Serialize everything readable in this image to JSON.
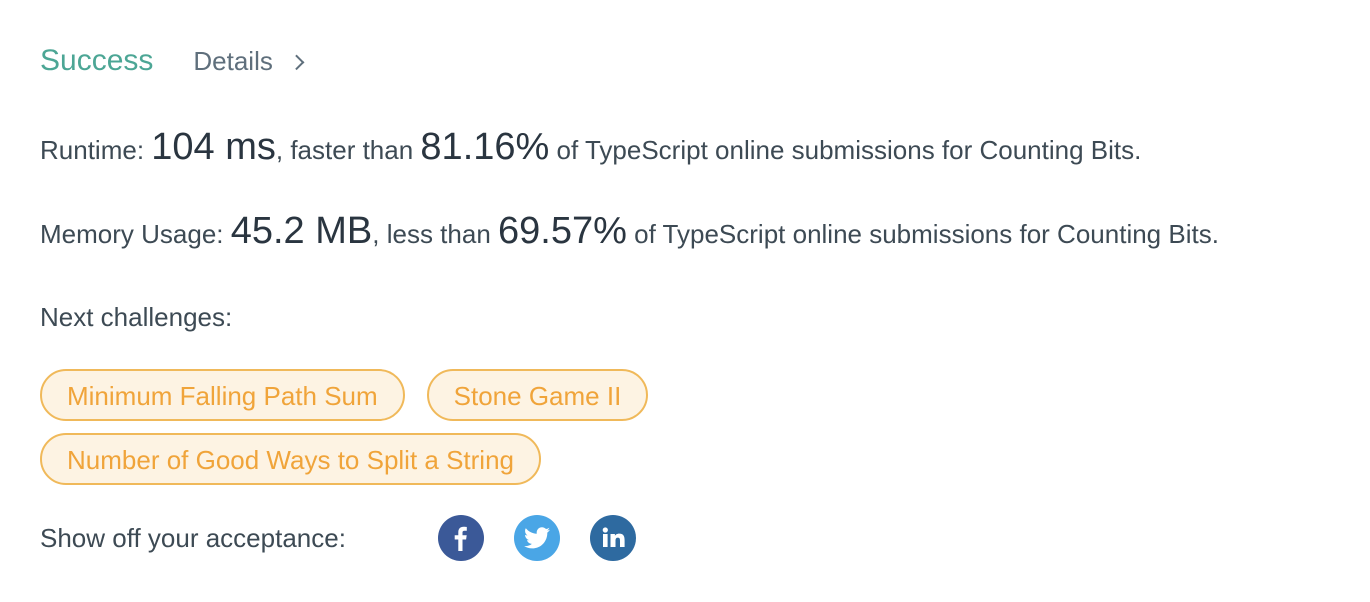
{
  "status": {
    "result": "Success",
    "details_label": "Details"
  },
  "runtime": {
    "label": "Runtime: ",
    "value": "104 ms",
    "comparison": ", faster than ",
    "percent": "81.16%",
    "suffix": " of TypeScript online submissions for Counting Bits."
  },
  "memory": {
    "label": "Memory Usage: ",
    "value": "45.2 MB",
    "comparison": ", less than ",
    "percent": "69.57%",
    "suffix": " of TypeScript online submissions for Counting Bits."
  },
  "next": {
    "label": "Next challenges:",
    "challenges": [
      "Minimum Falling Path Sum",
      "Stone Game II",
      "Number of Good Ways to Split a String"
    ]
  },
  "share": {
    "label": "Show off your acceptance:",
    "icons": [
      "facebook-icon",
      "twitter-icon",
      "linkedin-icon"
    ]
  },
  "colors": {
    "success": "#4ca695",
    "chip_border": "#f0b95a",
    "chip_text": "#f0a43a",
    "chip_bg": "#fdf3e3",
    "facebook": "#3b5998",
    "twitter": "#4aa6e6",
    "linkedin": "#2e6aa0"
  }
}
